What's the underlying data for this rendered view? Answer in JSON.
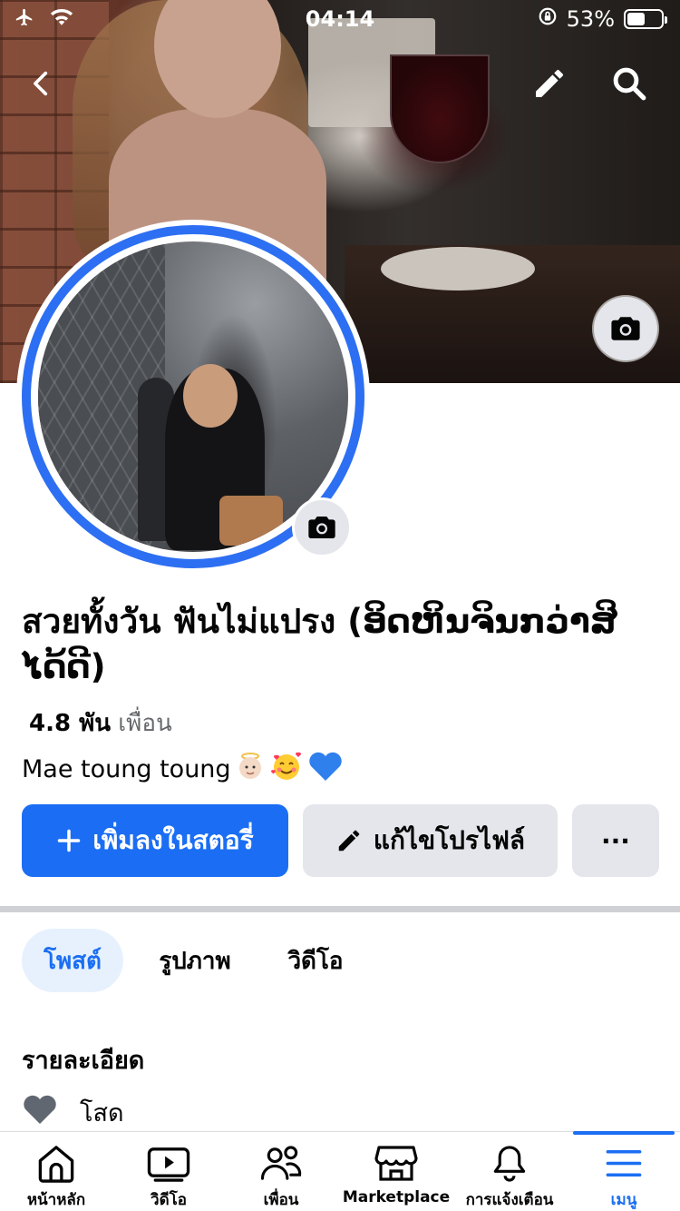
{
  "status_bar": {
    "time": "04:14",
    "battery": "53%",
    "battery_level": 0.53
  },
  "profile": {
    "name": "สวยทั้งวัน ฟันไม่แปรง (ອິດຫິນຈິນກວ່າສິໄດ້ດີ)",
    "friends_count": "4.8 พัน",
    "friends_label": "เพื่อน",
    "bio_text": "Mae toung toung"
  },
  "actions": {
    "add_story": "เพิ่มลงในสตอรี่",
    "edit_profile": "แก้ไขโปรไฟล์",
    "more": "···"
  },
  "tabs": [
    {
      "label": "โพสต์",
      "selected": true
    },
    {
      "label": "รูปภาพ",
      "selected": false
    },
    {
      "label": "วิดีโอ",
      "selected": false
    }
  ],
  "details": {
    "title": "รายละเอียด",
    "relationship": "โสด"
  },
  "bottom_nav": [
    {
      "label": "หน้าหลัก",
      "icon": "home-icon"
    },
    {
      "label": "วิดีโอ",
      "icon": "video-icon"
    },
    {
      "label": "เพื่อน",
      "icon": "friends-icon"
    },
    {
      "label": "Marketplace",
      "icon": "marketplace-icon"
    },
    {
      "label": "การแจ้งเตือน",
      "icon": "bell-icon"
    },
    {
      "label": "เมนู",
      "icon": "menu-icon",
      "active": true
    }
  ],
  "colors": {
    "accent": "#1b6ef3",
    "avatar_ring": "#2d6ff2",
    "secondary_button": "#e4e6eb"
  }
}
